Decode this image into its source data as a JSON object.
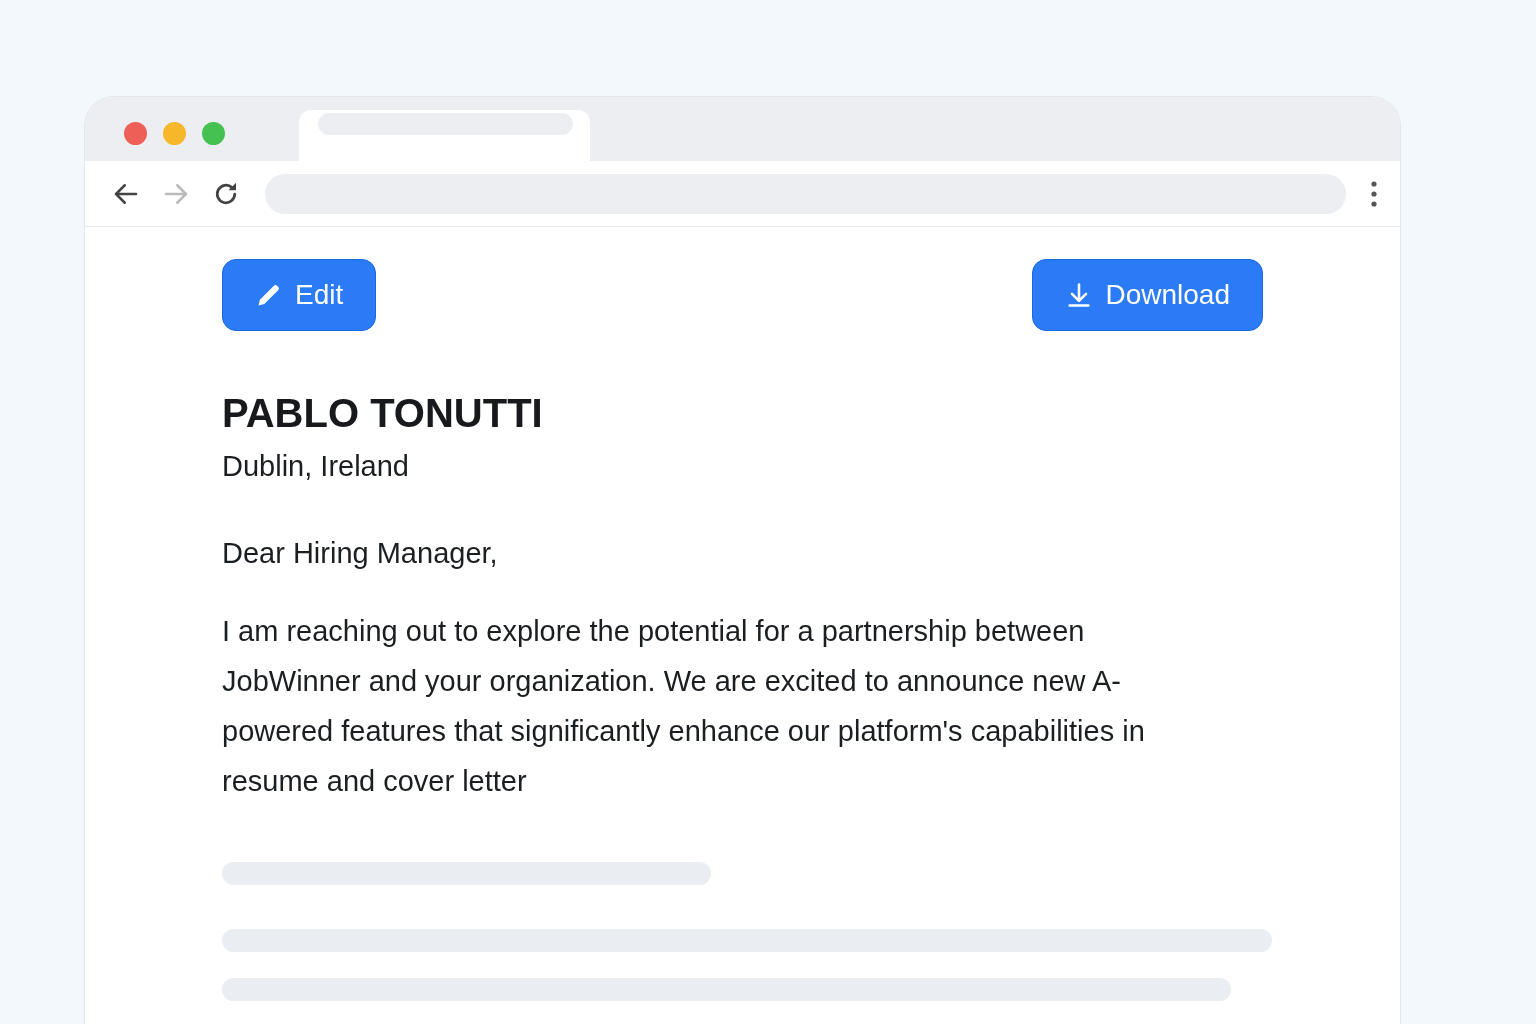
{
  "buttons": [
    {
      "kind": "edit",
      "label": "Edit"
    },
    {
      "kind": "download",
      "label": "Download"
    }
  ],
  "letter": {
    "name": "PABLO TONUTTI",
    "location": "Dublin, Ireland",
    "greeting": "Dear Hiring Manager,",
    "body": "I am reaching out to explore the potential for a partnership between JobWinner and your organization. We are excited to announce new A-powered features that significantly enhance our platform's capabilities in resume and cover letter"
  }
}
